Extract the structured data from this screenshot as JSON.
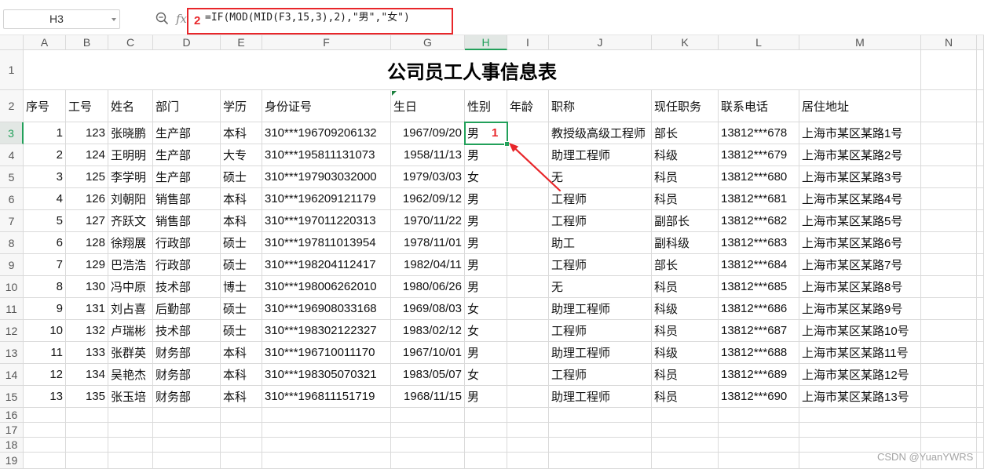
{
  "name_box": {
    "value": "H3"
  },
  "formula_bar": {
    "fx_label": "fx",
    "formula": "=IF(MOD(MID(F3,15,3),2),\"男\",\"女\")"
  },
  "icons": {
    "zoom": "zoom-icon",
    "function": "fx-icon",
    "name_box_dropdown": "chevron-down-icon"
  },
  "annotations": {
    "formula_step": "2",
    "cell_step": "1"
  },
  "colors": {
    "selection_green": "#22a05a",
    "annotation_red": "#e8262a",
    "gridline": "#dadada",
    "comment_marker": "#1a7f3c"
  },
  "columns": [
    "A",
    "B",
    "C",
    "D",
    "E",
    "F",
    "G",
    "H",
    "I",
    "J",
    "K",
    "L",
    "M",
    "N"
  ],
  "row_numbers": [
    "1",
    "2",
    "3",
    "4",
    "5",
    "6",
    "7",
    "8",
    "9",
    "10",
    "11",
    "12",
    "13",
    "14",
    "15",
    "16",
    "17",
    "18",
    "19"
  ],
  "title": "公司员工人事信息表",
  "headers": [
    "序号",
    "工号",
    "姓名",
    "部门",
    "学历",
    "身份证号",
    "生日",
    "性别",
    "年龄",
    "职称",
    "现任职务",
    "联系电话",
    "居住地址"
  ],
  "rows": [
    [
      1,
      123,
      "张晓鹏",
      "生产部",
      "本科",
      "310***196709206132",
      "1967/09/20",
      "男",
      "",
      "教授级高级工程师",
      "部长",
      "13812***678",
      "上海市某区某路1号"
    ],
    [
      2,
      124,
      "王明明",
      "生产部",
      "大专",
      "310***195811131073",
      "1958/11/13",
      "男",
      "",
      "助理工程师",
      "科级",
      "13812***679",
      "上海市某区某路2号"
    ],
    [
      3,
      125,
      "李学明",
      "生产部",
      "硕士",
      "310***197903032000",
      "1979/03/03",
      "女",
      "",
      "无",
      "科员",
      "13812***680",
      "上海市某区某路3号"
    ],
    [
      4,
      126,
      "刘朝阳",
      "销售部",
      "本科",
      "310***196209121179",
      "1962/09/12",
      "男",
      "",
      "工程师",
      "科员",
      "13812***681",
      "上海市某区某路4号"
    ],
    [
      5,
      127,
      "齐跃文",
      "销售部",
      "本科",
      "310***197011220313",
      "1970/11/22",
      "男",
      "",
      "工程师",
      "副部长",
      "13812***682",
      "上海市某区某路5号"
    ],
    [
      6,
      128,
      "徐翔展",
      "行政部",
      "硕士",
      "310***197811013954",
      "1978/11/01",
      "男",
      "",
      "助工",
      "副科级",
      "13812***683",
      "上海市某区某路6号"
    ],
    [
      7,
      129,
      "巴浩浩",
      "行政部",
      "硕士",
      "310***198204112417",
      "1982/04/11",
      "男",
      "",
      "工程师",
      "部长",
      "13812***684",
      "上海市某区某路7号"
    ],
    [
      8,
      130,
      "冯中原",
      "技术部",
      "博士",
      "310***198006262010",
      "1980/06/26",
      "男",
      "",
      "无",
      "科员",
      "13812***685",
      "上海市某区某路8号"
    ],
    [
      9,
      131,
      "刘占喜",
      "后勤部",
      "硕士",
      "310***196908033168",
      "1969/08/03",
      "女",
      "",
      "助理工程师",
      "科级",
      "13812***686",
      "上海市某区某路9号"
    ],
    [
      10,
      132,
      "卢瑞彬",
      "技术部",
      "硕士",
      "310***198302122327",
      "1983/02/12",
      "女",
      "",
      "工程师",
      "科员",
      "13812***687",
      "上海市某区某路10号"
    ],
    [
      11,
      133,
      "张群英",
      "财务部",
      "本科",
      "310***196710011170",
      "1967/10/01",
      "男",
      "",
      "助理工程师",
      "科级",
      "13812***688",
      "上海市某区某路11号"
    ],
    [
      12,
      134,
      "吴艳杰",
      "财务部",
      "本科",
      "310***198305070321",
      "1983/05/07",
      "女",
      "",
      "工程师",
      "科员",
      "13812***689",
      "上海市某区某路12号"
    ],
    [
      13,
      135,
      "张玉培",
      "财务部",
      "本科",
      "310***196811151719",
      "1968/11/15",
      "男",
      "",
      "助理工程师",
      "科员",
      "13812***690",
      "上海市某区某路13号"
    ]
  ],
  "watermark": "CSDN @YuanYWRS"
}
